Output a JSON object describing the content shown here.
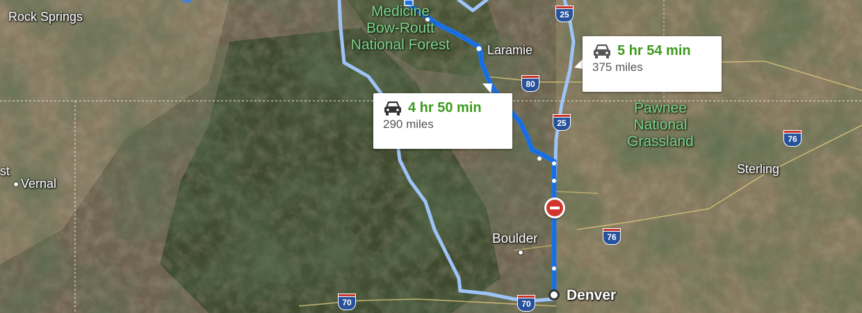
{
  "map": {
    "places": {
      "rock_springs": "Rock Springs",
      "vernal": "Vernal",
      "laramie": "Laramie",
      "sterling": "Sterling",
      "boulder": "Boulder",
      "denver": "Denver",
      "left_edge_fragment": "st"
    },
    "parks": {
      "medicine_bow": [
        "Medicine",
        "Bow-Routt",
        "National Forest"
      ],
      "pawnee": [
        "Pawnee",
        "National",
        "Grassland"
      ]
    },
    "highway_shields": {
      "i25_top": "25",
      "i25_mid": "25",
      "i80": "80",
      "i76_east": "76",
      "i76_south": "76",
      "i70_west": "70",
      "i70_denver": "70"
    },
    "routes": {
      "selected": {
        "duration": "4 hr 50 min",
        "distance": "290 miles",
        "mode_icon": "car-icon"
      },
      "alternate": {
        "duration": "5 hr 54 min",
        "distance": "375 miles",
        "mode_icon": "car-icon"
      }
    },
    "markers": {
      "restriction_icon": "no-entry-icon",
      "destination_icon": "destination-marker-icon"
    },
    "colors": {
      "selected_route": "#1a73e8",
      "alternate_route": "#9ec4f7",
      "duration_text": "#3c9a1c",
      "park_label": "#7fd38a",
      "shield_blue": "#27519a",
      "shield_red": "#c7352c",
      "restriction": "#d2352b"
    }
  }
}
